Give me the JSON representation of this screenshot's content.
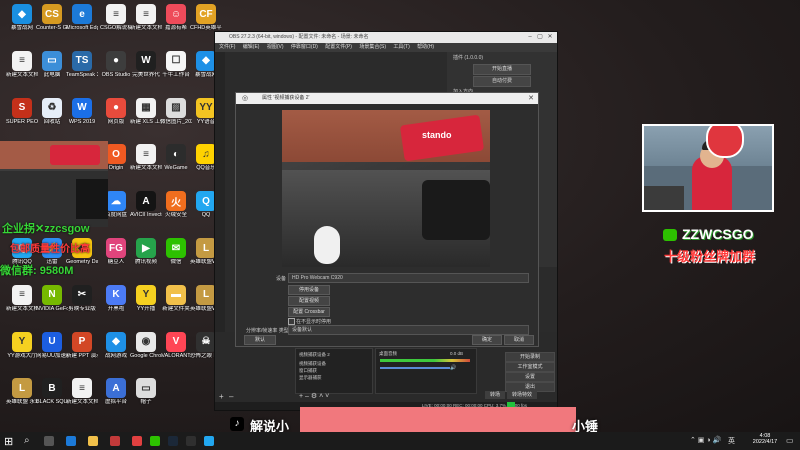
{
  "desktop_icons": [
    {
      "label": "暴雪战网",
      "color": "#1a8fe0",
      "glyph": "◆"
    },
    {
      "label": "Counter-S Global Off...",
      "color": "#d69a21",
      "glyph": "CS"
    },
    {
      "label": "Microsoft Edge",
      "color": "#1c7ad8",
      "glyph": "e"
    },
    {
      "label": "CSGO解说稿子",
      "color": "#f2f2f2",
      "glyph": "≡"
    },
    {
      "label": "新建文本文档(3)",
      "color": "#f2f2f2",
      "glyph": "≡"
    },
    {
      "label": "嘉源有希",
      "color": "#ee4b5a",
      "glyph": "☺"
    },
    {
      "label": "CFHD英雄平台",
      "color": "#e2a224",
      "glyph": "CF"
    },
    {
      "label": "新建文本文档",
      "color": "#f2f2f2",
      "glyph": "≡"
    },
    {
      "label": "此电脑",
      "color": "#3c8ed8",
      "glyph": "▭"
    },
    {
      "label": "TeamSpeak 3",
      "color": "#2a6aa8",
      "glyph": "TS"
    },
    {
      "label": "OBS Studio",
      "color": "#3d3d3d",
      "glyph": "●"
    },
    {
      "label": "完美世界代",
      "color": "#202020",
      "glyph": "W"
    },
    {
      "label": "千牛工作台",
      "color": "#f6f6f6",
      "glyph": "☐"
    },
    {
      "label": "暴雪战网",
      "color": "#1e90e6",
      "glyph": "◆"
    },
    {
      "label": "SUPER PEOPLE CBT",
      "color": "#c4301a",
      "glyph": "S"
    },
    {
      "label": "回收站",
      "color": "#e6eef8",
      "glyph": "♻"
    },
    {
      "label": "WPS 2019",
      "color": "#1b6fe8",
      "glyph": "W"
    },
    {
      "label": "网页版",
      "color": "#e84b3c",
      "glyph": "●"
    },
    {
      "label": "新建 XLS 工作表",
      "color": "#f2f2f2",
      "glyph": "▦"
    },
    {
      "label": "微信图片_2021072...",
      "color": "#dddddd",
      "glyph": "▨"
    },
    {
      "label": "YY语音",
      "color": "#f3c422",
      "glyph": "YY"
    },
    {
      "label": "Launcher",
      "color": "#b02a2a",
      "glyph": "L"
    },
    {
      "label": "控制面板",
      "color": "#3d7bd0",
      "glyph": "▤"
    },
    {
      "label": "酷狗音乐",
      "color": "#2187e6",
      "glyph": "K"
    },
    {
      "label": "Origin",
      "color": "#f05a22",
      "glyph": "O"
    },
    {
      "label": "新建文本文档(2)",
      "color": "#f2f2f2",
      "glyph": "≡"
    },
    {
      "label": "WeGame",
      "color": "#2c2c2c",
      "glyph": "◐"
    },
    {
      "label": "QQ音乐",
      "color": "#ffd200",
      "glyph": "♫"
    },
    {
      "label": "网易有道翻译",
      "color": "#d63a2a",
      "glyph": "翻"
    },
    {
      "label": "双人成行",
      "color": "#3d8b41",
      "glyph": "⛰"
    },
    {
      "label": "Steam",
      "color": "#1b2838",
      "glyph": "S"
    },
    {
      "label": "百度网盘",
      "color": "#2f86f6",
      "glyph": "☁"
    },
    {
      "label": "AVICII Invector",
      "color": "#141414",
      "glyph": "A"
    },
    {
      "label": "火绒安全",
      "color": "#f06e1e",
      "glyph": "火"
    },
    {
      "label": "QQ",
      "color": "#22a7f0",
      "glyph": "Q"
    },
    {
      "label": "腾讯QQ",
      "color": "#22a7f0",
      "glyph": "Q"
    },
    {
      "label": "迅雷",
      "color": "#2d8cf0",
      "glyph": "⚡"
    },
    {
      "label": "Geometry Dash",
      "color": "#f5c310",
      "glyph": "◆"
    },
    {
      "label": "糖豆人",
      "color": "#e0447c",
      "glyph": "FG"
    },
    {
      "label": "腾讯视频",
      "color": "#26a34b",
      "glyph": "▶"
    },
    {
      "label": "微信",
      "color": "#2dc100",
      "glyph": "✉"
    },
    {
      "label": "英雄联盟WeGame版",
      "color": "#c49a42",
      "glyph": "L"
    },
    {
      "label": "新建文本文档",
      "color": "#f2f2f2",
      "glyph": "≡"
    },
    {
      "label": "NVIDIA GeForce",
      "color": "#76b900",
      "glyph": "N"
    },
    {
      "label": "剪映专业版",
      "color": "#202020",
      "glyph": "✂"
    },
    {
      "label": "开黑啦",
      "color": "#4c7bf5",
      "glyph": "K"
    },
    {
      "label": "YY开播",
      "color": "#f5d020",
      "glyph": "Y"
    },
    {
      "label": "新建文件夹",
      "color": "#f1c04a",
      "glyph": "▬"
    },
    {
      "label": "英雄联盟WeGame版",
      "color": "#c49a42",
      "glyph": "L"
    },
    {
      "label": "YY游戏大厅",
      "color": "#f5d020",
      "glyph": "Y"
    },
    {
      "label": "网易UU加速器",
      "color": "#1c5ee0",
      "glyph": "U"
    },
    {
      "label": "新建 PPT 演示文稿",
      "color": "#d24726",
      "glyph": "P"
    },
    {
      "label": "战网游戏",
      "color": "#1e90e6",
      "glyph": "◆"
    },
    {
      "label": "Google Chrome",
      "color": "#e8e8e8",
      "glyph": "◉"
    },
    {
      "label": "VALORANT",
      "color": "#ff4655",
      "glyph": "V"
    },
    {
      "label": "恐怖之眼 Fear surv...",
      "color": "#303030",
      "glyph": "☠"
    },
    {
      "label": "英雄联盟 永劫无间",
      "color": "#c49a42",
      "glyph": "L"
    },
    {
      "label": "BLACK SQUAD",
      "color": "#202020",
      "glyph": "B"
    },
    {
      "label": "新建文本文档(4)",
      "color": "#f2f2f2",
      "glyph": "≡"
    },
    {
      "label": "虚拟平台",
      "color": "#3b6fd6",
      "glyph": "A"
    },
    {
      "label": "帽子",
      "color": "#dddddd",
      "glyph": "▭"
    }
  ],
  "obs": {
    "title": "OBS 27.2.3 (64-bit, windows) - 配置文件: 未命名 - 场景: 未命名",
    "menu": [
      "文件(F)",
      "编辑(E)",
      "视图(V)",
      "停靠窗口(D)",
      "配置文件(P)",
      "场景集合(S)",
      "工具(T)",
      "帮助(H)"
    ],
    "right_panel_header": "插件 (1.0.0.0)",
    "right_buttons": [
      "开始直播",
      "自动付费"
    ],
    "right_label": "加入方向",
    "bottom_controls": [
      "开始录制",
      "工作室模式",
      "设置",
      "退出"
    ],
    "status_buttons": [
      "转场",
      "转场特效"
    ],
    "status_text": "LIVE: 00:00:00  REC: 00:00:00  CPU: 3.7%, 60.00 fps",
    "sources": [
      "视频捕获设备 2",
      "视频捕获设备",
      "窗口捕获",
      "显示器捕获"
    ],
    "mixer_label": "桌面音频",
    "mixer_value": "0.0 dB"
  },
  "dialog": {
    "title": "属性 '视频捕获设备 2'",
    "device_label": "设备",
    "device_value": "HD Pro Webcam C920",
    "buttons": [
      "停用设备",
      "配置视频",
      "配置 Crossbar"
    ],
    "checkbox_label": "在不显示时停用",
    "resolution_label": "分辨率/帧速率 类型",
    "resolution_value": "设备默认",
    "default_button": "默认",
    "ok_button": "确定",
    "cancel_button": "取消"
  },
  "overlays": {
    "left_title": "企业拐✕zzcsgow",
    "left_line2": "包邮质量性价比高",
    "left_line3": "微信群: 9580M",
    "right_title": "ZZWCSGO",
    "right_subtitle": "十级粉丝牌加群",
    "bottom_left": "解说小",
    "bottom_right": "小锤"
  },
  "taskbar": {
    "time": "4:08",
    "date": "2022/4/17",
    "lang": "英"
  },
  "colors": {
    "desktop": "#231d1d",
    "obs_bg": "#2b2b2b",
    "green_overlay": "#35d435",
    "red_overlay": "#ff3b3b",
    "pink_block": "#f1787d"
  }
}
